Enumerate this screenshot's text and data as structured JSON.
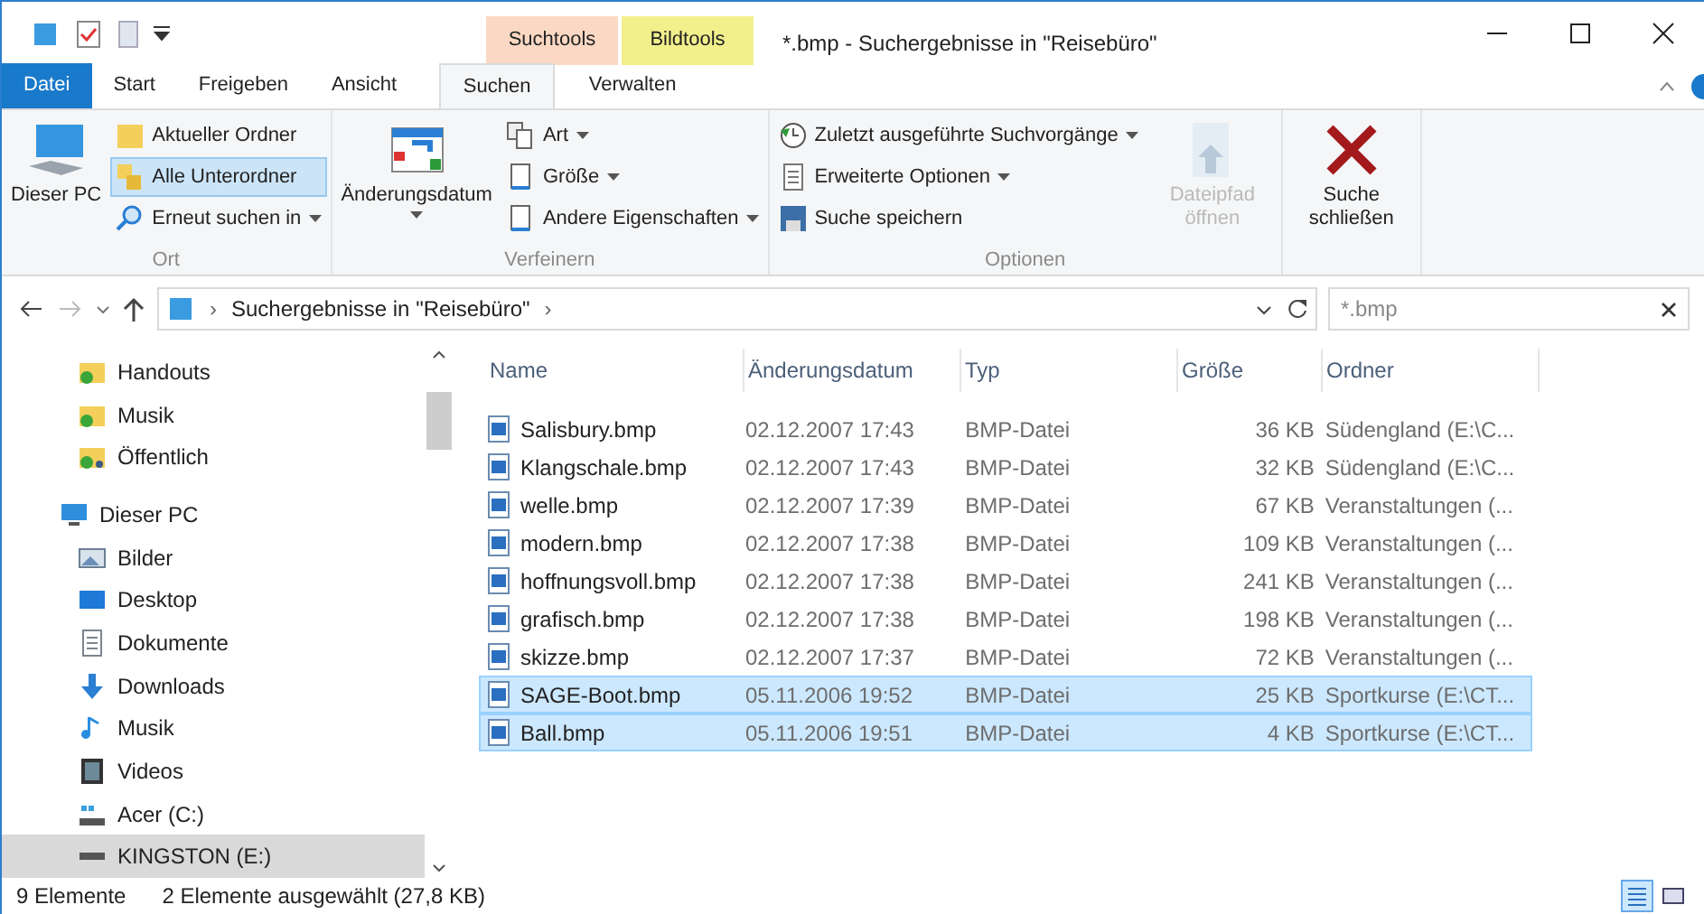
{
  "window": {
    "title": "*.bmp - Suchergebnisse in \"Reisebüro\""
  },
  "tabs": [
    {
      "label": "Datei",
      "kind": "file",
      "selected": false
    },
    {
      "label": "Start",
      "kind": "normal",
      "selected": false
    },
    {
      "label": "Freigeben",
      "kind": "normal",
      "selected": false
    },
    {
      "label": "Ansicht",
      "kind": "normal",
      "selected": false
    }
  ],
  "tab_groups": [
    {
      "label": "Suchtools",
      "color": "#fad8c3",
      "tabs": [
        {
          "label": "Suchen",
          "selected": true
        }
      ]
    },
    {
      "label": "Bildtools",
      "color": "#f2f08c",
      "tabs": [
        {
          "label": "Verwalten",
          "selected": false
        }
      ]
    }
  ],
  "ribbon": [
    {
      "label": "Ort",
      "items": [
        {
          "kind": "large",
          "label": "Dieser PC",
          "dropdown": false,
          "disabled": false
        },
        {
          "kind": "stack",
          "items": [
            {
              "label": "Aktueller Ordner",
              "selected": false,
              "dropdown": false
            },
            {
              "label": "Alle Unterordner",
              "selected": true,
              "dropdown": false
            },
            {
              "label": "Erneut suchen in",
              "selected": false,
              "dropdown": true
            }
          ]
        }
      ]
    },
    {
      "label": "Verfeinern",
      "items": [
        {
          "kind": "large",
          "label": "Änderungsdatum",
          "dropdown": true,
          "disabled": false
        },
        {
          "kind": "stack",
          "items": [
            {
              "label": "Art",
              "selected": false,
              "dropdown": true
            },
            {
              "label": "Größe",
              "selected": false,
              "dropdown": true
            },
            {
              "label": "Andere Eigenschaften",
              "selected": false,
              "dropdown": true
            }
          ]
        }
      ]
    },
    {
      "label": "Optionen",
      "items": [
        {
          "kind": "stack",
          "items": [
            {
              "label": "Zuletzt ausgeführte Suchvorgänge",
              "selected": false,
              "dropdown": true
            },
            {
              "label": "Erweiterte Optionen",
              "selected": false,
              "dropdown": true
            },
            {
              "label": "Suche speichern",
              "selected": false,
              "dropdown": false
            }
          ]
        },
        {
          "kind": "large",
          "label": "Dateipfad öffnen",
          "dropdown": false,
          "disabled": true
        }
      ]
    },
    {
      "items": [
        {
          "kind": "large",
          "label": "Suche schließen",
          "dropdown": false,
          "disabled": false
        }
      ]
    }
  ],
  "address": {
    "path": "Suchergebnisse in \"Reisebüro\"",
    "separator": "›",
    "search_value": "*.bmp"
  },
  "nav": [
    {
      "label": "Handouts",
      "kind": "synced-folder",
      "selected": false
    },
    {
      "label": "Musik",
      "kind": "synced-folder",
      "selected": false
    },
    {
      "label": "Öffentlich",
      "kind": "shared-folder",
      "selected": false
    },
    {
      "label": "Dieser PC",
      "kind": "pc",
      "selected": false,
      "children": [
        {
          "label": "Bilder",
          "kind": "pictures",
          "selected": false
        },
        {
          "label": "Desktop",
          "kind": "desktop",
          "selected": false
        },
        {
          "label": "Dokumente",
          "kind": "documents",
          "selected": false
        },
        {
          "label": "Downloads",
          "kind": "downloads",
          "selected": false
        },
        {
          "label": "Musik",
          "kind": "music",
          "selected": false
        },
        {
          "label": "Videos",
          "kind": "videos",
          "selected": false
        },
        {
          "label": "Acer (C:)",
          "kind": "system-drive",
          "selected": false
        },
        {
          "label": "KINGSTON (E:)",
          "kind": "usb-drive",
          "selected": true
        }
      ]
    }
  ],
  "table": {
    "columns": [
      "Name",
      "Änderungsdatum",
      "Typ",
      "Größe",
      "Ordner"
    ],
    "rows": [
      {
        "name": "Salisbury.bmp",
        "date": "02.12.2007 17:43",
        "type": "BMP-Datei",
        "size": "36 KB",
        "folder": "Südengland (E:\\C...",
        "selected": false
      },
      {
        "name": "Klangschale.bmp",
        "date": "02.12.2007 17:43",
        "type": "BMP-Datei",
        "size": "32 KB",
        "folder": "Südengland (E:\\C...",
        "selected": false
      },
      {
        "name": "welle.bmp",
        "date": "02.12.2007 17:39",
        "type": "BMP-Datei",
        "size": "67 KB",
        "folder": "Veranstaltungen (...",
        "selected": false
      },
      {
        "name": "modern.bmp",
        "date": "02.12.2007 17:38",
        "type": "BMP-Datei",
        "size": "109 KB",
        "folder": "Veranstaltungen (...",
        "selected": false
      },
      {
        "name": "hoffnungsvoll.bmp",
        "date": "02.12.2007 17:38",
        "type": "BMP-Datei",
        "size": "241 KB",
        "folder": "Veranstaltungen (...",
        "selected": false
      },
      {
        "name": "grafisch.bmp",
        "date": "02.12.2007 17:38",
        "type": "BMP-Datei",
        "size": "198 KB",
        "folder": "Veranstaltungen (...",
        "selected": false
      },
      {
        "name": "skizze.bmp",
        "date": "02.12.2007 17:37",
        "type": "BMP-Datei",
        "size": "72 KB",
        "folder": "Veranstaltungen (...",
        "selected": false
      },
      {
        "name": "SAGE-Boot.bmp",
        "date": "05.11.2006 19:52",
        "type": "BMP-Datei",
        "size": "25 KB",
        "folder": "Sportkurse (E:\\CT...",
        "selected": true
      },
      {
        "name": "Ball.bmp",
        "date": "05.11.2006 19:51",
        "type": "BMP-Datei",
        "size": "4 KB",
        "folder": "Sportkurse (E:\\CT...",
        "selected": true
      }
    ]
  },
  "status_bar": {
    "count": "9 Elemente",
    "selection": "2 Elemente ausgewählt (27,8 KB)",
    "views": [
      {
        "kind": "details",
        "selected": true
      },
      {
        "kind": "thumbnails",
        "selected": false
      }
    ]
  }
}
